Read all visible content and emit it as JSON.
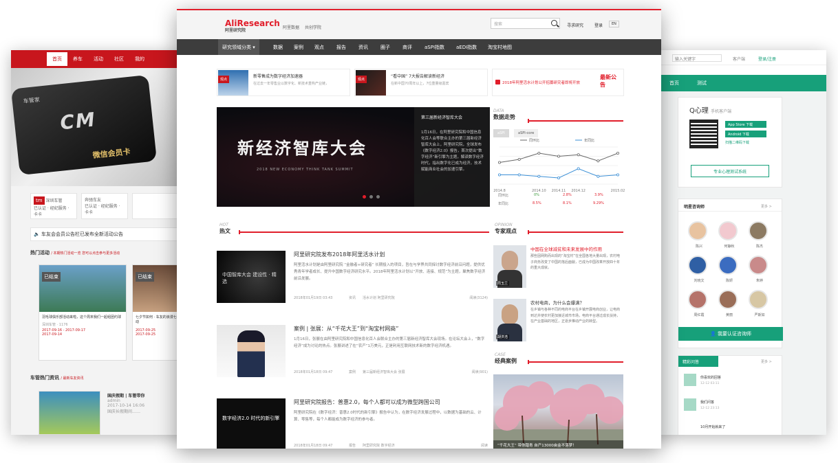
{
  "left_site": {
    "nav": [
      "首页",
      "养车",
      "活动",
      "社区",
      "我的"
    ],
    "card_brand": "车管家",
    "card_logo": "CM",
    "card_caption": "微信会员卡",
    "brand_label_1": "深圳车管",
    "brand_label_2": "奔驰车友",
    "brand_note_1": "已认证 · 经纪服务 · 卡卡",
    "brand_note_2": "已认证 · 经纪服务 · 卡卡",
    "notice": "车友会会员公告栏已发布全新活动公告",
    "section1": "热门活动",
    "section1_sub": "/ 本期热门活动一览 您可以点击参与更多活动",
    "act1_tag": "已结束",
    "act1_title": "羽毛球俱乐部活动来啦，这个周末我们一起组团约球",
    "act1_owner": "深圳车管",
    "act1_views": "1176",
    "act1_d1": "2017-09-16",
    "act1_d2": "2017-09-17",
    "act1_d3": "2017-09-14",
    "act2_tag": "已结束",
    "act2_title": "七夕节如何 · 车友的浪漫七夕活动",
    "act2_d1": "2017-09-25",
    "act2_d2": "2017-09-25",
    "section2": "车管热门资讯",
    "section2_sub": "/ 最新车友资讯",
    "news_title": "国庆假期 | 车管带你",
    "news_author": "admin",
    "news_date": "2017-10-14 16:06",
    "news_snip": "国庆长假期间……"
  },
  "center_site": {
    "logo_main": "AliResearch",
    "logo_sub": "阿里研究院",
    "header_links": [
      "阿里数据",
      "共创学院"
    ],
    "search_placeholder": "搜索",
    "header_right": [
      "寻求研究",
      "登录",
      "EN"
    ],
    "menu": [
      "研究领域分类",
      "数据",
      "案例",
      "观点",
      "报告",
      "资讯",
      "圈子",
      "商评",
      "aSPI指数",
      "aEDI指数",
      "淘宝村地图"
    ],
    "news_box1": {
      "tag": "观点",
      "title": "新零售成为数字经济加速器",
      "snip": "在过去一年零售业以数字化、新技术重构产业链，"
    },
    "news_box2": {
      "tag": "观点",
      "title": "“看中国” 7大报告解读新经济",
      "snip": "在新中国70周年以上，7位重量级嘉宾"
    },
    "notice_text": "2018年阿里活水计划公开招募研究者即将开放",
    "notice_label": "最新公告",
    "hero_title": "新经济智库大会",
    "hero_en": "2018 NEW ECONOMY THINK TANK SUMMIT",
    "hero_side_title": "第三届新经济智库大会",
    "hero_side_body": "1月16日，在阿里研究院和中国信息化百人会等联合主办的第三届新经济智库大会上，阿里研究院，全球发布《数字经济2.0》报告，首次提出“数字经济”新引擎为主题，解读数字经济时代，指出数字化已成为经济，技术赋能商业社会的加速引擎。",
    "data_label": "DATA",
    "data_title": "数据走势",
    "chart_tabs": [
      "aSPI",
      "aSPI-core"
    ],
    "chart_data": {
      "type": "line",
      "categories": [
        "2014.08",
        "2014.09",
        "2014.10",
        "2014.11",
        "2014.12",
        "2015.01",
        "2015.02"
      ],
      "x_ticks": [
        "2014.8",
        "2014.10",
        "2014.11",
        "2014.12",
        "2015.02"
      ],
      "series": [
        {
          "name": "同环比",
          "values": [
            14,
            16,
            20,
            18,
            19,
            15,
            20
          ],
          "color": "#666666"
        },
        {
          "name": "年同比",
          "values": [
            6,
            6,
            5,
            4,
            10,
            5,
            6
          ],
          "color": "#3b8fd6"
        }
      ]
    },
    "stats": {
      "rows": [
        "同环比",
        "年同比"
      ],
      "col1": [
        "0%",
        "8.5%"
      ],
      "col2": [
        "2.8%",
        "8.1%"
      ],
      "col3": [
        "3.9%",
        "9.29%"
      ]
    },
    "hot_label": "HOT",
    "hot_title": "热文",
    "articles": [
      {
        "title": "阿里研究院发布2018年阿里活水计划",
        "body": "阿里活水计划是由阿里研究院 “金融者+研究者” 长期投入的项目，旨在与学界共同探讨数字经济前沿问题，提供优秀青年学者成长、提升中国数字经济研究水平。2018年阿里活水计划以“开放、连接、规范”为主题，聚焦数字经济前沿发展。",
        "date": "2018年01月19日 03:43",
        "cat": "资讯",
        "tags": "活水计划  阿里研究院",
        "reads": "阅读(3124)"
      },
      {
        "title": "案例 | 张展：从“千花大王”到“淘宝村网商”",
        "body": "1月16日，张展在由阿里研究院和中国信息化百人会联合主办的第三届新经济智库大会现场。在论坛大会上，“数字经济”成为讨论的热点。张展讲述了在“农产”1万美元，正是利用互联网技术新的数字经济机遇。",
        "date": "2018年01月18日 09:47",
        "cat": "案例",
        "tags": "第三届新经济智库大会  张展",
        "reads": "阅读(901)"
      },
      {
        "title": "阿里研究院报告：普惠2.0，每个人都可以成为微型跨国公司",
        "body": "阿里研究院在《数字经济：普惠2.0时代的新引擎》报告中认为，在数字经济发展过程中，以数据为基础的云、计算、零售等，每个人都能成为数字经济的参与者。",
        "date": "2018年01月18日 09:47",
        "cat": "报告",
        "tags": "阿里研究院  数字经济",
        "reads": "阅读"
      }
    ],
    "thumb_labels": [
      "中国智库大会 建设性 · 精选",
      "",
      "数字经济2.0 时代的新引擎"
    ],
    "opinion_label": "OPINION",
    "opinion_title": "专家观点",
    "opinions": [
      {
        "title": "中国在全球减贫和未来发展中的作用",
        "body": "那些因网购而出现的“淘宝村”在全国各地大量出现，农村电子商务改变了中国的落后面貌，已成为中国改革开放四十年的重大成就。",
        "name": "周玉兰"
      },
      {
        "title": "农村电商，为什么会爆满？",
        "body": "在乡镇与各种不同的电商平台在乡镇开展电商创业，让电商到达并使农村更加接近城市市场，电商平台通过成长扶持，在产业基础的地区，正逐步推动产业的转型。",
        "name": "胡洪浩"
      }
    ],
    "case_label": "CASE",
    "case_title": "经典案例",
    "case_caption": "“千花大王” 带你踏青 自产13000亩金不落梦！"
  },
  "right_site": {
    "top_placeholder": "输入关键字",
    "top_links": [
      "客户端",
      "登录/注册"
    ],
    "green_menu": [
      "首页",
      "测试"
    ],
    "app_title": "Q心理",
    "app_sub": "手机客户端",
    "app_buttons": [
      "App Store 下载",
      "Android 下载",
      "扫描二维码下载"
    ],
    "test_button": "专业心理测试系统",
    "counselor_title": "明星咨询师",
    "more": "更多 >",
    "counselors": [
      "陈兴",
      "何静秋",
      "陈杰",
      "刘晓文",
      "陈妍",
      "朱婷",
      "周红霞",
      "黄丽",
      "严斯如"
    ],
    "cert_button": "我要认证咨询师",
    "qa_title": "精彩问答",
    "qa": [
      {
        "title": "你喜欢的回答",
        "date": "12-12 03:11"
      },
      {
        "title": "我们问答",
        "date": "12-12 23:13"
      },
      {
        "title": "10月开始就来了",
        "date": ""
      }
    ]
  }
}
